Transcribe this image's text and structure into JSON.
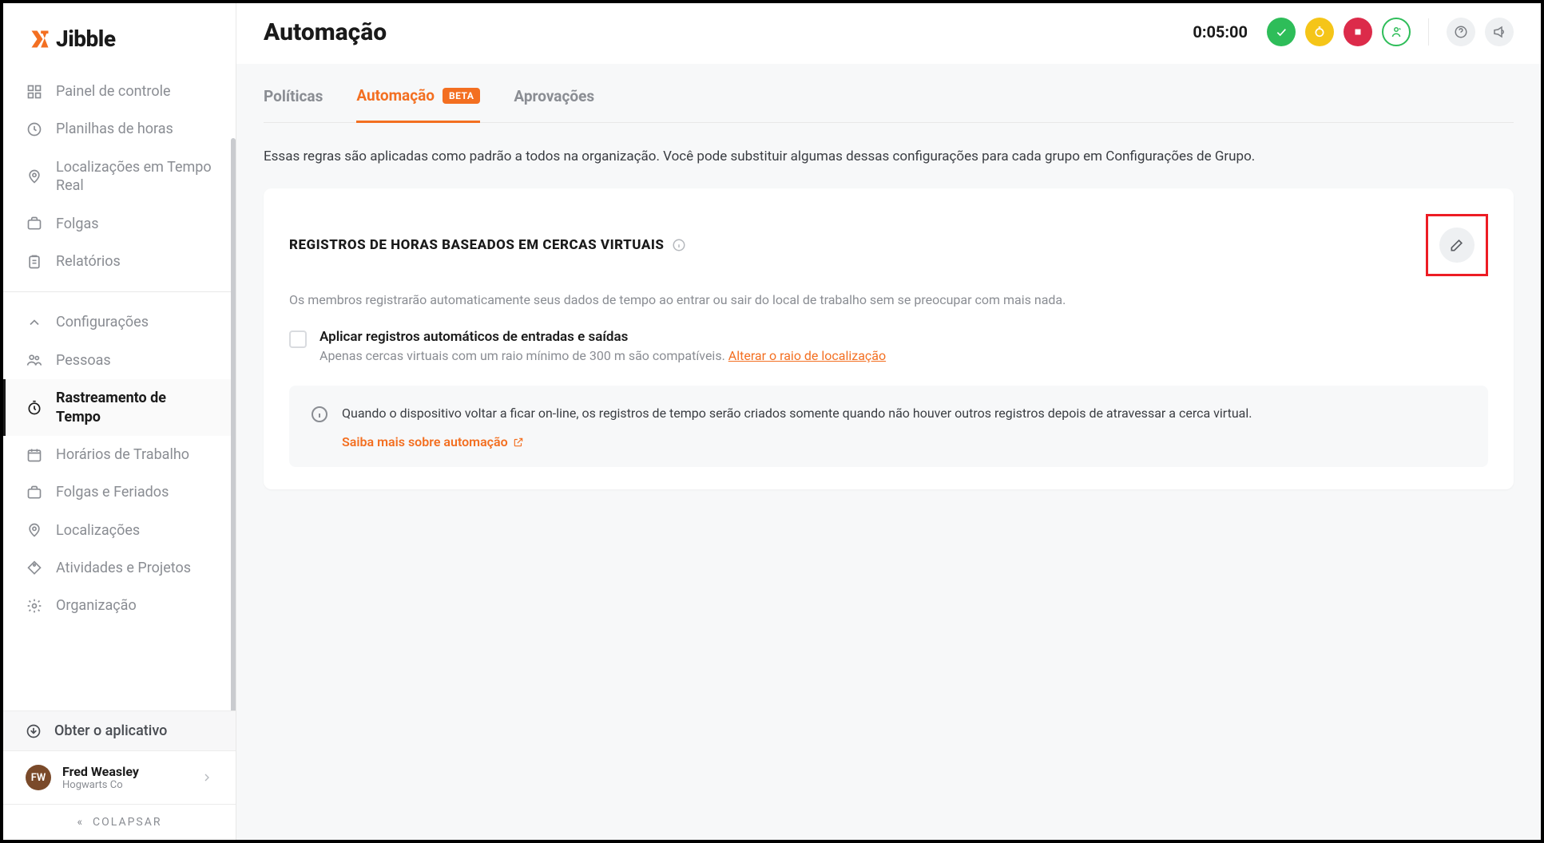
{
  "brand": "Jibble",
  "header": {
    "title": "Automação",
    "timer": "0:05:00"
  },
  "sidebar": {
    "items1": [
      {
        "label": "Painel de controle"
      },
      {
        "label": "Planilhas de horas"
      },
      {
        "label": "Localizações em Tempo Real"
      },
      {
        "label": "Folgas"
      },
      {
        "label": "Relatórios"
      }
    ],
    "items2": [
      {
        "label": "Configurações"
      },
      {
        "label": "Pessoas"
      },
      {
        "label": "Rastreamento de Tempo"
      },
      {
        "label": "Horários de Trabalho"
      },
      {
        "label": "Folgas e Feriados"
      },
      {
        "label": "Localizações"
      },
      {
        "label": "Atividades e Projetos"
      },
      {
        "label": "Organização"
      }
    ],
    "get_app": "Obter o aplicativo",
    "user": {
      "name": "Fred Weasley",
      "org": "Hogwarts Co"
    },
    "collapse": "COLAPSAR"
  },
  "tabs": {
    "policies": "Políticas",
    "automation": "Automação",
    "automation_badge": "BETA",
    "approvals": "Aprovações"
  },
  "intro": "Essas regras são aplicadas como padrão a todos na organização. Você pode substituir algumas dessas configurações para cada grupo em Configurações de Grupo.",
  "card": {
    "title": "REGISTROS DE HORAS BASEADOS EM CERCAS VIRTUAIS",
    "desc": "Os membros registrarão automaticamente seus dados de tempo ao entrar ou sair do local de trabalho sem se preocupar com mais nada.",
    "option_title": "Aplicar registros automáticos de entradas e saídas",
    "option_sub_prefix": "Apenas cercas virtuais com um raio mínimo de 300 m são compatíveis. ",
    "option_link": "Alterar o raio de localização",
    "note": "Quando o dispositivo voltar a ficar on-line, os registros de tempo serão criados somente quando não houver outros registros depois de atravessar a cerca virtual.",
    "learn_more": "Saiba mais sobre automação"
  }
}
